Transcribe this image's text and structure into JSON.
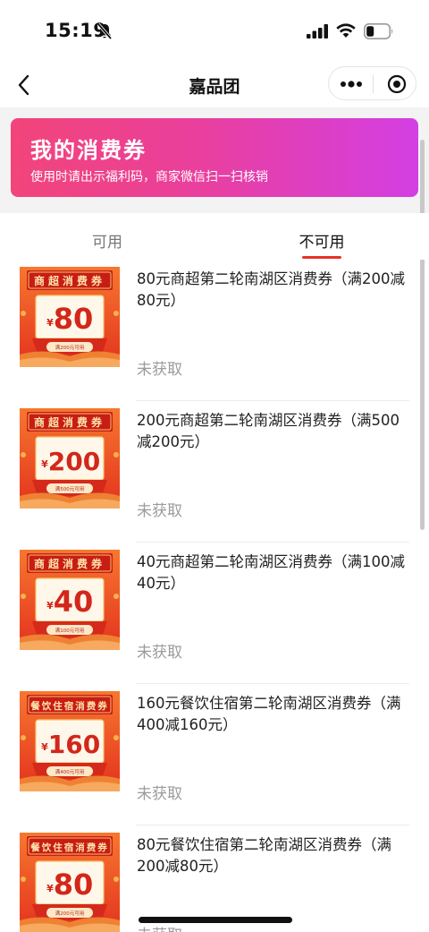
{
  "status_bar": {
    "time": "15:19"
  },
  "nav": {
    "title": "嘉品团"
  },
  "banner": {
    "title": "我的消费券",
    "subtitle": "使用时请出示福利码，商家微信扫一扫核销"
  },
  "tabs": [
    {
      "label": "可用"
    },
    {
      "label": "不可用"
    }
  ],
  "selected_tab": "不可用",
  "colors": {
    "accent_red": "#e53226",
    "banner_start": "#f2457a",
    "banner_end": "#d33fe3"
  },
  "coupons": [
    {
      "title": "80元商超第二轮南湖区消费券（满200减80元）",
      "status": "未获取",
      "thumb": {
        "header": "商超消费券",
        "amount": "80",
        "currency": "¥",
        "condition": "满200元可用"
      }
    },
    {
      "title": "200元商超第二轮南湖区消费券（满500减200元）",
      "status": "未获取",
      "thumb": {
        "header": "商超消费券",
        "amount": "200",
        "currency": "¥",
        "condition": "满500元可用"
      }
    },
    {
      "title": "40元商超第二轮南湖区消费券（满100减40元）",
      "status": "未获取",
      "thumb": {
        "header": "商超消费券",
        "amount": "40",
        "currency": "¥",
        "condition": "满100元可用"
      }
    },
    {
      "title": "160元餐饮住宿第二轮南湖区消费券（满400减160元）",
      "status": "未获取",
      "thumb": {
        "header": "餐饮住宿消费券",
        "amount": "160",
        "currency": "¥",
        "condition": "满400元可用"
      }
    },
    {
      "title": "80元餐饮住宿第二轮南湖区消费券（满200减80元）",
      "status": "未获取",
      "thumb": {
        "header": "餐饮住宿消费券",
        "amount": "80",
        "currency": "¥",
        "condition": "满200元可用"
      }
    }
  ]
}
